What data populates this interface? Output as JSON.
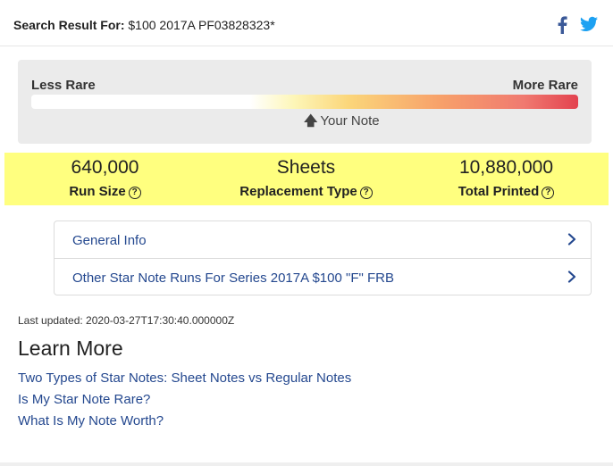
{
  "header": {
    "search_label": "Search Result For:",
    "search_query": "$100 2017A PF03828323*",
    "icons": [
      "facebook-icon",
      "twitter-icon"
    ],
    "facebook_color": "#3b5998",
    "twitter_color": "#1da1f2"
  },
  "rarity": {
    "less_label": "Less Rare",
    "more_label": "More Rare",
    "marker_label": "Your Note",
    "marker_icon": "arrow-up-icon"
  },
  "stats": [
    {
      "value": "640,000",
      "caption": "Run Size"
    },
    {
      "value": "Sheets",
      "caption": "Replacement Type"
    },
    {
      "value": "10,880,000",
      "caption": "Total Printed"
    }
  ],
  "stats_highlight_color": "#ffff7f",
  "accordion": [
    {
      "label": "General Info"
    },
    {
      "label": "Other Star Note Runs For Series 2017A $100 \"F\" FRB"
    }
  ],
  "last_updated": "Last updated: 2020-03-27T17:30:40.000000Z",
  "learn_more": {
    "title": "Learn More",
    "links": [
      "Two Types of Star Notes: Sheet Notes vs Regular Notes",
      "Is My Star Note Rare?",
      "What Is My Note Worth?"
    ]
  },
  "link_color": "#24488f"
}
